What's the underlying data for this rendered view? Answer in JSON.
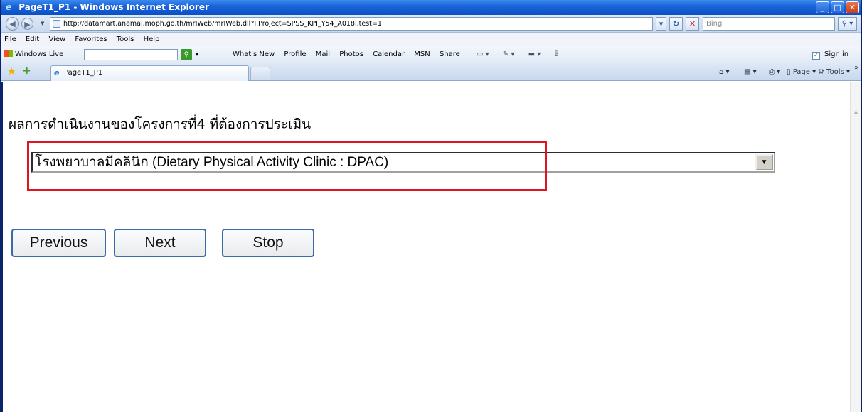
{
  "window": {
    "title": "PageT1_P1 - Windows Internet Explorer",
    "min_glyph": "_",
    "max_glyph": "□",
    "close_glyph": "✕"
  },
  "address": {
    "url": "http://datamart.anamai.moph.go.th/mrIWeb/mrIWeb.dll?I.Project=SPSS_KPI_Y54_A018i.test=1",
    "search_placeholder": "Bing",
    "search_go_glyph": "⚲ ▾"
  },
  "menu": {
    "items": [
      "File",
      "Edit",
      "View",
      "Favorites",
      "Tools",
      "Help"
    ]
  },
  "live_toolbar": {
    "brand": "Windows Live",
    "links": [
      "What's New",
      "Profile",
      "Mail",
      "Photos",
      "Calendar",
      "MSN",
      "Share"
    ],
    "signin": "Sign in"
  },
  "tabs": {
    "active_tab": "PageT1_P1"
  },
  "command_bar": {
    "page_label": "Page",
    "tools_label": "Tools"
  },
  "page": {
    "heading": "ผลการดำเนินงานของโครงการที่4  ที่ต้องการประเมิน",
    "select_value": "โรงพยาบาลมีคลินิก (Dietary Physical Activity Clinic : DPAC)",
    "buttons": {
      "previous": "Previous",
      "next": "Next",
      "stop": "Stop"
    }
  },
  "colors": {
    "highlight": "#e0141e",
    "titlebar": "#1c64d8"
  }
}
